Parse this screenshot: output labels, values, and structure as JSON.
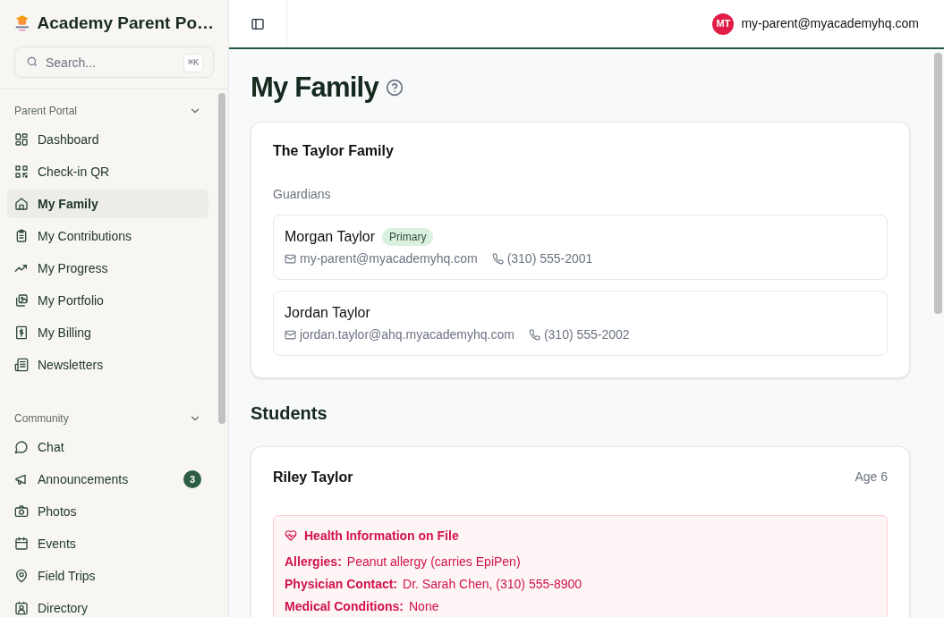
{
  "app": {
    "title": "Academy Parent Po…"
  },
  "search": {
    "placeholder": "Search...",
    "shortcut": "⌘K"
  },
  "sidebar": {
    "sections": [
      {
        "label": "Parent Portal",
        "expanded": true,
        "items": [
          {
            "label": "Dashboard",
            "selected": false
          },
          {
            "label": "Check-in QR",
            "selected": false
          },
          {
            "label": "My Family",
            "selected": true
          },
          {
            "label": "My Contributions",
            "selected": false
          },
          {
            "label": "My Progress",
            "selected": false
          },
          {
            "label": "My Portfolio",
            "selected": false
          },
          {
            "label": "My Billing",
            "selected": false
          },
          {
            "label": "Newsletters",
            "selected": false
          }
        ]
      },
      {
        "label": "Community",
        "expanded": true,
        "items": [
          {
            "label": "Chat",
            "selected": false
          },
          {
            "label": "Announcements",
            "selected": false,
            "badge": "3"
          },
          {
            "label": "Photos",
            "selected": false
          },
          {
            "label": "Events",
            "selected": false
          },
          {
            "label": "Field Trips",
            "selected": false
          },
          {
            "label": "Directory",
            "selected": false
          }
        ]
      }
    ]
  },
  "header": {
    "avatar": "MT",
    "user": "my-parent@myacademyhq.com"
  },
  "page": {
    "title": "My Family"
  },
  "family": {
    "title": "The Taylor Family",
    "guardians_label": "Guardians",
    "guardians": [
      {
        "name": "Morgan Taylor",
        "badge": "Primary",
        "email": "my-parent@myacademyhq.com",
        "phone": "(310) 555-2001"
      },
      {
        "name": "Jordan Taylor",
        "email": "jordan.taylor@ahq.myacademyhq.com",
        "phone": "(310) 555-2002"
      }
    ]
  },
  "students_label": "Students",
  "students": [
    {
      "name": "Riley Taylor",
      "age": "Age 6",
      "health": {
        "title": "Health Information on File",
        "fields": [
          {
            "label": "Allergies:",
            "value": "Peanut allergy (carries EpiPen)"
          },
          {
            "label": "Physician Contact:",
            "value": "Dr. Sarah Chen, (310) 555-8900"
          },
          {
            "label": "Medical Conditions:",
            "value": "None"
          }
        ]
      }
    }
  ]
}
